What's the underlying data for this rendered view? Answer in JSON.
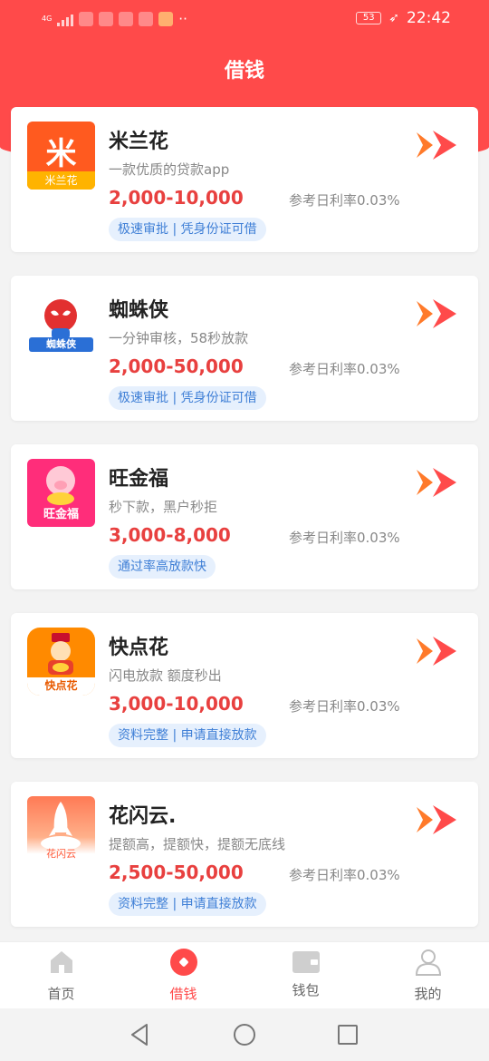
{
  "status_bar": {
    "time": "22:42",
    "battery": "53",
    "network": "4G"
  },
  "header": {
    "title": "借钱"
  },
  "loans": [
    {
      "name": "米兰花",
      "desc": "一款优质的贷款app",
      "amount": "2,000-10,000",
      "rate": "参考日利率0.03%",
      "tag": "极速审批 | 凭身份证可借",
      "logo_text": "米兰花",
      "logo_glyph": "米",
      "logo_color": "#ff5a1f"
    },
    {
      "name": "蜘蛛侠",
      "desc": "一分钟审核，58秒放款",
      "amount": "2,000-50,000",
      "rate": "参考日利率0.03%",
      "tag": "极速审批 | 凭身份证可借",
      "logo_text": "蜘蛛侠",
      "logo_color": "#2a6fd6"
    },
    {
      "name": "旺金福",
      "desc": "秒下款，黑户秒拒",
      "amount": "3,000-8,000",
      "rate": "参考日利率0.03%",
      "tag": "通过率高放款快",
      "logo_text": "旺金福",
      "logo_color": "#ff2d7a"
    },
    {
      "name": "快点花",
      "desc": "闪电放款 额度秒出",
      "amount": "3,000-10,000",
      "rate": "参考日利率0.03%",
      "tag": "资料完整 | 申请直接放款",
      "logo_text": "快点花",
      "logo_color": "#ff8a00"
    },
    {
      "name": "花闪云.",
      "desc": "提额高，提额快，提额无底线",
      "amount": "2,500-50,000",
      "rate": "参考日利率0.03%",
      "tag": "资料完整 | 申请直接放款",
      "logo_text": "花闪云",
      "logo_color": "#ff7a55"
    }
  ],
  "nav": [
    {
      "label": "首页",
      "icon": "home-icon",
      "active": false
    },
    {
      "label": "借钱",
      "icon": "borrow-icon",
      "active": true
    },
    {
      "label": "钱包",
      "icon": "wallet-icon",
      "active": false
    },
    {
      "label": "我的",
      "icon": "profile-icon",
      "active": false
    }
  ],
  "colors": {
    "brand_red": "#ff4a4a",
    "amount_red": "#e8403f",
    "tag_blue": "#3f7fd6"
  }
}
